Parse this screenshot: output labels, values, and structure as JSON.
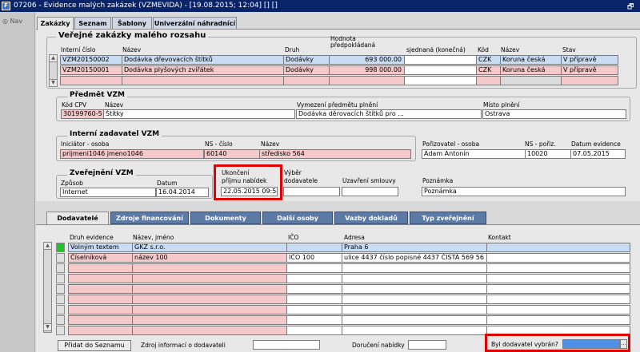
{
  "titlebar": {
    "text": "07206 - Evidence malých zakázek (VZMEVIDA) - [19.08.2015; 12:04] [] []",
    "restore": "🗗"
  },
  "nav": {
    "label": "Nav"
  },
  "tabs": [
    "Zakázky",
    "Seznam",
    "Šablony",
    "Univerzální náhradnící"
  ],
  "section_title": "Veřejné zakázky malého rozsahu",
  "grid_headers": {
    "interni": "Interní číslo",
    "nazev": "Název",
    "druh": "Druh",
    "hodnota_l1": "Hodnota",
    "hodnota_l2": "předpokládaná",
    "sjednana": "sjednaná (konečná)",
    "kod": "Kód",
    "mnazev": "Název",
    "stav": "Stav"
  },
  "grid_rows": [
    {
      "interni": "VZM20150002",
      "nazev": "Dodávka dřevovacích štítků",
      "druh": "Dodávky",
      "hodnota": "693 000.00",
      "sjednana": "",
      "kod": "CZK",
      "mena": "Koruna česká",
      "stav": "V přípravě"
    },
    {
      "interni": "VZM20150001",
      "nazev": "Dodávka plyšových zvířátek",
      "druh": "Dodávky",
      "hodnota": "998 000.00",
      "sjednana": "",
      "kod": "CZK",
      "mena": "Koruna česká",
      "stav": "V přípravě"
    }
  ],
  "predmet": {
    "title": "Předmět VZM",
    "kod_lbl": "Kód CPV",
    "nazev_lbl": "Název",
    "vym_lbl": "Vymezení předmětu plnění",
    "misto_lbl": "Místo plnění",
    "kod": "30199760-5",
    "nazev": "Štítky",
    "vymezeni": "Dodávka děrovacích štítků pro ...",
    "misto": "Ostrava"
  },
  "zadavatel": {
    "title": "Interní zadavatel VZM",
    "ini_lbl": "Iniciátor - osoba",
    "ns_lbl": "NS - číslo",
    "nazev_lbl": "Název",
    "ini": "prijmeni1046 jmeno1046",
    "ns": "60140",
    "nazev": "středisko 564"
  },
  "porizovatel": {
    "lbl": "Pořizovatel - osoba",
    "ns_lbl": "NS - pořiz.",
    "datum_lbl": "Datum evidence",
    "osoba": "Adam Antonín",
    "ns": "10020",
    "datum": "07.05.2015"
  },
  "zverejneni": {
    "title": "Zveřejnění VZM",
    "zpusob_lbl": "Způsob",
    "datum_lbl": "Datum",
    "zpusob": "Internet",
    "datum": "16.04.2014"
  },
  "ukonceni": {
    "l1": "Ukončení",
    "l2": "příjmu nabídek",
    "value": "22.05.2015 09:54"
  },
  "vyber": {
    "l1": "Výběr",
    "l2": "dodavatele",
    "value": ""
  },
  "uzavreni": {
    "lbl": "Uzavření smlouvy",
    "value": ""
  },
  "poznamka": {
    "lbl": "Poznámka",
    "value": "Poznámka"
  },
  "bottom_tabs": [
    "Dodavatelé",
    "Zdroje financování",
    "Dokumenty",
    "Další osoby",
    "Vazby dokladů",
    "Typ zveřejnění"
  ],
  "dod_headers": {
    "druh": "Druh evidence",
    "nazev": "Název, jméno",
    "ico": "IČO",
    "adresa": "Adresa",
    "kontakt": "Kontakt"
  },
  "dod_rows": [
    {
      "druh": "Volným textem",
      "nazev": "GKZ s.r.o.",
      "ico": "",
      "adresa": "Praha 6",
      "kontakt": ""
    },
    {
      "druh": "Číselníková",
      "nazev": "název 100",
      "ico": "IČO 100",
      "adresa": "ulice 4437 číslo popisné 4437 ČISTÁ 569 56",
      "kontakt": ""
    }
  ],
  "footer": {
    "pridat": "Přidat do Seznamu",
    "zdroj_lbl": "Zdroj informací o dodavateli",
    "doruceni_lbl": "Doručení nabídky",
    "vybran_lbl": "Byl dodavatel vybrán?"
  }
}
